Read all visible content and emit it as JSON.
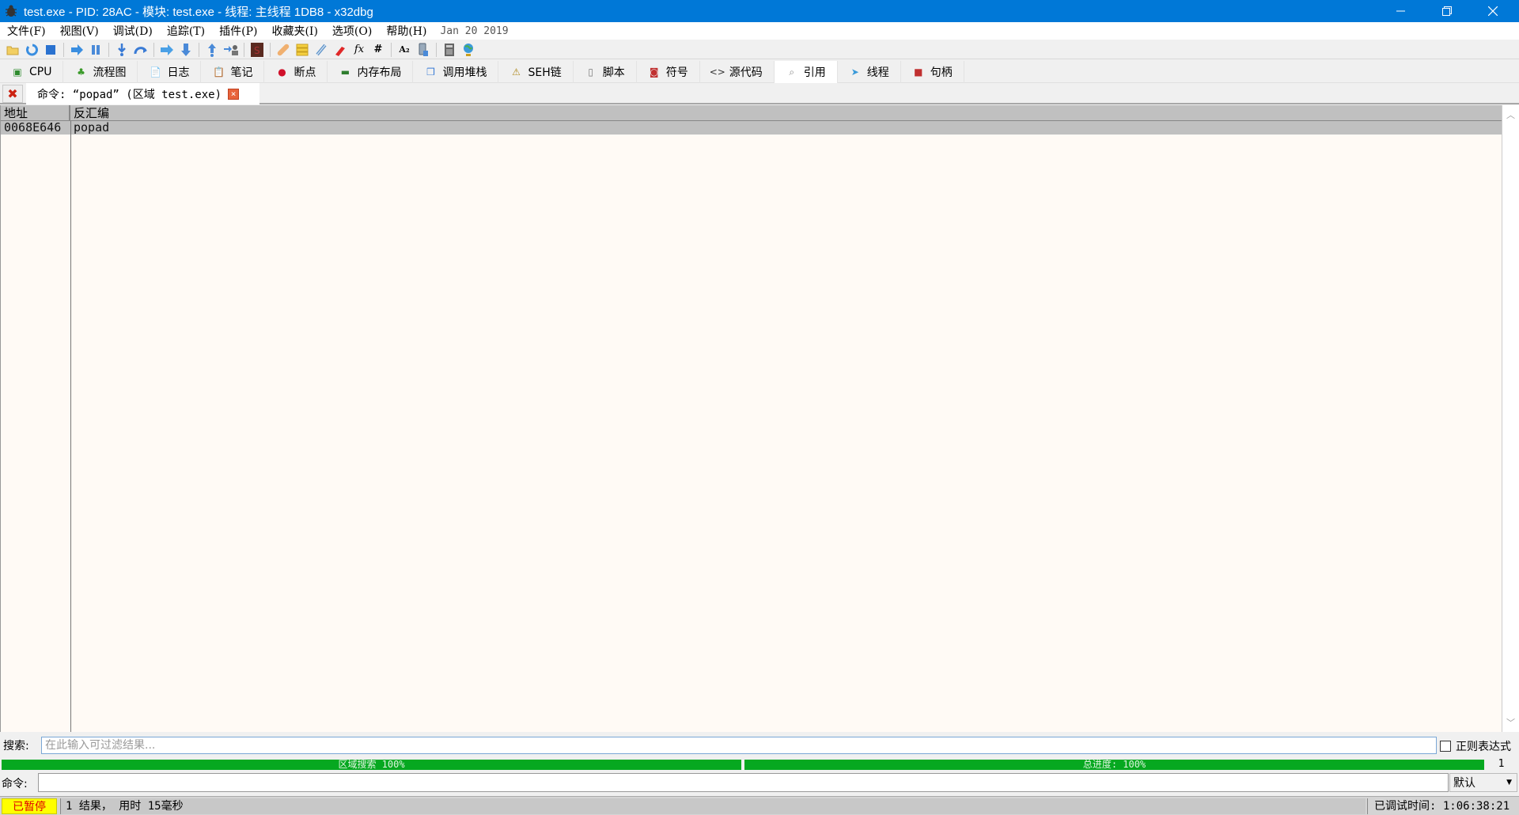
{
  "window": {
    "title": "test.exe - PID: 28AC - 模块: test.exe - 线程: 主线程 1DB8 - x32dbg",
    "minimize": "—",
    "restore": "❐",
    "close": "✕"
  },
  "menu": {
    "items": [
      "文件(F)",
      "视图(V)",
      "调试(D)",
      "追踪(T)",
      "插件(P)",
      "收藏夹(I)",
      "选项(O)",
      "帮助(H)"
    ],
    "build_date": "Jan 20 2019"
  },
  "toolbar": {
    "icons": [
      "open-folder",
      "restart",
      "stop",
      "run",
      "pause",
      "step-into",
      "step-over",
      "trace-into",
      "trace-over",
      "execute-till-return",
      "run-to-user-code",
      "scylla",
      "patches",
      "comments",
      "labels",
      "bookmarks",
      "functions",
      "hash",
      "strings",
      "calculator-device",
      "memory",
      "globe"
    ],
    "fx_label": "fx",
    "hash_label": "#",
    "strings_label": "A₂"
  },
  "tabs": [
    {
      "label": "CPU",
      "icon": "cpu-icon",
      "color": "#2e8b2e",
      "glyph": "▣"
    },
    {
      "label": "流程图",
      "icon": "tree-icon",
      "color": "#3a9a2a",
      "glyph": "♣"
    },
    {
      "label": "日志",
      "icon": "log-icon",
      "color": "#777",
      "glyph": "📄"
    },
    {
      "label": "笔记",
      "icon": "notes-icon",
      "color": "#777",
      "glyph": "📋"
    },
    {
      "label": "断点",
      "icon": "breakpoint-icon",
      "color": "#d0102a",
      "glyph": "●"
    },
    {
      "label": "内存布局",
      "icon": "memory-map-icon",
      "color": "#2e7d2e",
      "glyph": "▬"
    },
    {
      "label": "调用堆栈",
      "icon": "call-stack-icon",
      "color": "#3a7bd5",
      "glyph": "❒"
    },
    {
      "label": "SEH链",
      "icon": "seh-icon",
      "color": "#b08a20",
      "glyph": "⚠"
    },
    {
      "label": "脚本",
      "icon": "script-icon",
      "color": "#777",
      "glyph": "▯"
    },
    {
      "label": "符号",
      "icon": "symbols-icon",
      "color": "#c03030",
      "glyph": "◙"
    },
    {
      "label": "源代码",
      "icon": "source-icon",
      "color": "#333",
      "glyph": "<>"
    },
    {
      "label": "引用",
      "icon": "references-icon",
      "color": "#888",
      "glyph": "⌕",
      "active": true
    },
    {
      "label": "线程",
      "icon": "threads-icon",
      "color": "#3a9ad9",
      "glyph": "➤"
    },
    {
      "label": "句柄",
      "icon": "handles-icon",
      "color": "#c03030",
      "glyph": "■"
    }
  ],
  "subtab": {
    "label": "命令: “popad” (区域 test.exe)",
    "close": "×"
  },
  "table": {
    "columns": [
      "地址",
      "反汇编"
    ],
    "rows": [
      {
        "address": "0068E646",
        "disassembly": "popad"
      }
    ]
  },
  "search": {
    "label": "搜索:",
    "placeholder": "在此输入可过滤结果...",
    "value": "",
    "regex_label": "正则表达式",
    "regex_checked": false
  },
  "progress": {
    "region": {
      "label": "区域搜索 100%",
      "percent": 100
    },
    "total": {
      "label": "总进度: 100%",
      "percent": 100
    },
    "count": "1"
  },
  "command": {
    "label": "命令:",
    "value": "",
    "mode": "默认"
  },
  "status": {
    "state": "已暂停",
    "message": "1 结果， 用时 15毫秒",
    "debug_time": "已调试时间:  1:06:38:21"
  }
}
